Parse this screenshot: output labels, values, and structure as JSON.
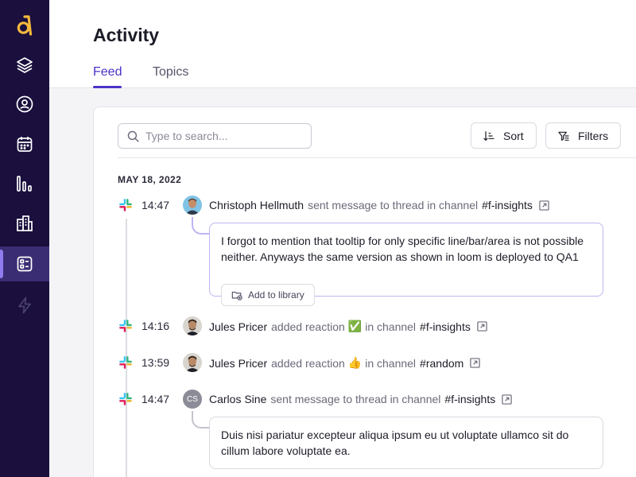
{
  "nav": {
    "logo": "logo-icon",
    "items": [
      {
        "icon": "layers-icon"
      },
      {
        "icon": "user-circle-icon"
      },
      {
        "icon": "calendar-icon"
      },
      {
        "icon": "bar-chart-icon"
      },
      {
        "icon": "buildings-icon"
      },
      {
        "icon": "feed-icon",
        "active": true
      },
      {
        "icon": "lightning-icon"
      }
    ]
  },
  "header": {
    "title": "Activity",
    "tabs": [
      {
        "label": "Feed",
        "active": true
      },
      {
        "label": "Topics"
      }
    ]
  },
  "toolbar": {
    "search_placeholder": "Type to search...",
    "sort_label": "Sort",
    "filters_label": "Filters"
  },
  "feed": {
    "date": "MAY 18, 2022",
    "events": [
      {
        "time": "14:47",
        "user": "Christoph Hellmuth",
        "action": "sent message to thread in channel",
        "channel": "#f-insights",
        "message": "I forgot to mention that tooltip for only specific line/bar/area is not possible neither. Anyways the same version as shown in loom is deployed to QA1",
        "button": "Add to library"
      },
      {
        "time": "14:16",
        "user": "Jules Pricer",
        "action": "added reaction",
        "emoji": "✅",
        "action_suffix": "in channel",
        "channel": "#f-insights"
      },
      {
        "time": "13:59",
        "user": "Jules Pricer",
        "action": "added reaction",
        "emoji": "👍",
        "action_suffix": "in channel",
        "channel": "#random"
      },
      {
        "time": "14:47",
        "user": "Carlos Sine",
        "initials": "CS",
        "action": "sent message to thread in channel",
        "channel": "#f-insights",
        "message": "Duis nisi pariatur excepteur aliqua ipsum eu ut voluptate ullamco sit do cillum labore voluptate ea."
      }
    ]
  },
  "colors": {
    "sidebar": "#1a0f3d",
    "accent": "#4a33c8",
    "logo": "#f5b83d",
    "highlight_border": "#bfb4f2"
  }
}
